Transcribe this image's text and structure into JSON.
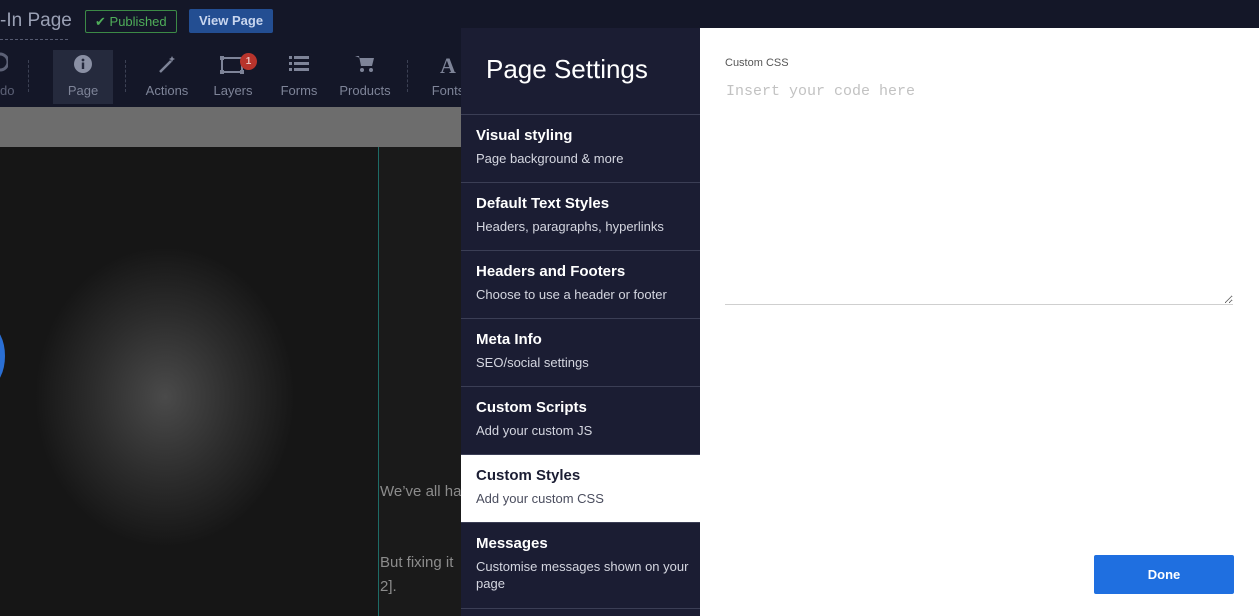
{
  "editor": {
    "page_title": "-In Page",
    "published_label": "Published",
    "view_page_label": "View Page",
    "undo_label": "do",
    "tools": [
      {
        "icon": "info-icon",
        "label": "Page"
      },
      {
        "icon": "magic-wand-icon",
        "label": "Actions"
      },
      {
        "icon": "layers-icon",
        "label": "Layers",
        "badge": "1"
      },
      {
        "icon": "list-icon",
        "label": "Forms"
      },
      {
        "icon": "cart-icon",
        "label": "Products"
      },
      {
        "icon": "font-icon",
        "label": "Fonts"
      }
    ],
    "canvas_text": [
      "We’ve all ha",
      "But fixing it",
      "2]."
    ]
  },
  "settings": {
    "title": "Page Settings",
    "nav": [
      {
        "title": "Visual styling",
        "subtitle": "Page background & more"
      },
      {
        "title": "Default Text Styles",
        "subtitle": "Headers, paragraphs, hyperlinks"
      },
      {
        "title": "Headers and Footers",
        "subtitle": "Choose to use a header or footer"
      },
      {
        "title": "Meta Info",
        "subtitle": "SEO/social settings"
      },
      {
        "title": "Custom Scripts",
        "subtitle": "Add your custom JS"
      },
      {
        "title": "Custom Styles",
        "subtitle": "Add your custom CSS",
        "selected": true
      },
      {
        "title": "Messages",
        "subtitle": "Customise messages shown on your page"
      }
    ],
    "custom_css": {
      "label": "Custom CSS",
      "placeholder": "Insert your code here",
      "value": ""
    },
    "done_label": "Done"
  },
  "colors": {
    "panel_nav_bg": "#1b1d33",
    "accent_blue": "#1f6fe0",
    "published_green": "#4fae59",
    "badge_red": "#b8342c"
  }
}
